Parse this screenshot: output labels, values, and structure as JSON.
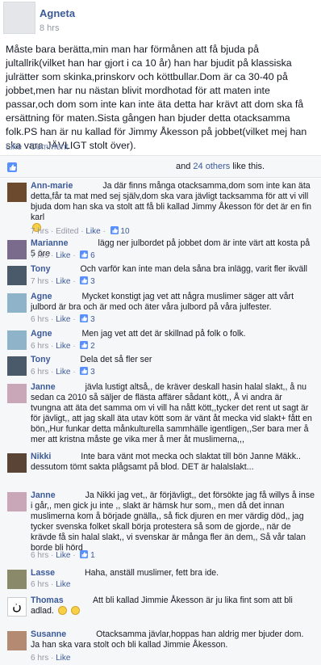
{
  "post": {
    "author": "Agneta",
    "time": "8 hrs",
    "text": "Måste bara berätta,min man har förmånen att få bjuda på jultallrik(vilket han har gjort i ca 10 år) han har bjudit på klassiska julrätter som skinka,prinskorv och köttbullar.Dom är ca 30-40 på jobbet,men har nu nästan blivit mordhotad för att maten inte passar,och dom som inte kan inte äta detta har krävt att dom ska få ersättning för maten.Sista gången han bjuder detta otacksamma folk.PS han är nu kallad för Jimmy Åkesson på jobbet(vilket mej han ska vara JÄVLIGT stolt över).",
    "like_label": "Like",
    "comment_label": "Comment",
    "likes_prefix": "and",
    "likes_link": "24 others",
    "likes_suffix": "like this."
  },
  "comments": [
    {
      "name": "Ann-marie",
      "text": "Ja där finns många otacksamma,dom som inte kan äta detta,får ta mat med sej själv,dom ska vara jävligt tacksamma för att vi vill bjuda dom han ska va stolt att få bli kallad Jimmy Åkesson för det är en fin karl",
      "time": "7 hrs",
      "edited": "Edited",
      "like": "Like",
      "count": "10"
    },
    {
      "name": "Marianne",
      "text": "lägg ner julbordet på jobbet dom är inte värt att kosta på 5 öre",
      "time": "7 hrs",
      "like": "Like",
      "count": "6"
    },
    {
      "name": "Tony",
      "text": "Och varför kan inte man dela såna bra inlägg, varit fler ikväll",
      "time": "7 hrs",
      "like": "Like",
      "count": "3"
    },
    {
      "name": "Agne",
      "text": "Mycket konstigt jag vet att några muslimer säger att vårt julbord är bra och är med och äter våra julbord på våra julfester.",
      "time": "6 hrs",
      "like": "Like",
      "count": "3"
    },
    {
      "name": "Agne",
      "text": "Men jag vet att det är skillnad på folk o folk.",
      "time": "6 hrs",
      "like": "Like",
      "count": "2"
    },
    {
      "name": "Tony",
      "text": "Dela det så fler ser",
      "time": "6 hrs",
      "like": "Like",
      "count": "3"
    },
    {
      "name": "Janne",
      "text": "jävla lustigt altså,, de kräver deskall hasin halal slakt,, å nu sedan ca 2010 så säljer de flästa affärer sådant kött,, Å vi andra är tvungna att äta det samma om vi vill ha nått kött,,tycker det rent ut sagt är för jävligt,, att jag skall äta utav kött som är vänt åt mecka vid slakt+ fått en bön,,Hur funkar detta månkulturella sammhälle igentligen,,Ser bara mer å mer att kristna måste ge vika mer å mer åt muslimerna,,,",
      "time": "",
      "like": "",
      "count": ""
    },
    {
      "name": "Nikki",
      "text": "Inte bara vänt mot mecka och slaktat till bön Janne Mäkk.. dessutom tömt sakta plågsamt på blod. DET är halalslakt...",
      "time": "",
      "like": "",
      "count": ""
    },
    {
      "name": "Janne",
      "text": "Ja Nikki jag vet,, är förjävligt,, det försökte jag få willys å inse i går,, men gick ju inte ,, slakt är hämsk hur som,, men då det innan muslimerna kom å började gnälla,, så fick djuren en mer värdig död,, jag tycker svenska folket skall börja protestera så som de gjorde,, när de krävde få sin halal slakt,, vi svenskar är många fler än dem,, Så vår talan borde bli hörd",
      "time": "6 hrs",
      "like": "Like",
      "count": "1"
    },
    {
      "name": "Lasse",
      "text": "Haha, anställ muslimer, fett bra ide.",
      "time": "6 hrs",
      "like": "Like",
      "count": ""
    },
    {
      "name": "Thomas",
      "text": "Att bli kallad Jimmie Åkesson är ju lika fint som att bli adlad.",
      "time": "",
      "like": "",
      "count": ""
    },
    {
      "name": "Susanne",
      "text": "Otacksamma jävlar,hoppas han aldrig mer bjuder dom. Ja han ska vara stolt och bli kallad Jimmie Åkesson.",
      "time": "6 hrs",
      "like": "Like",
      "count": ""
    }
  ],
  "colors": {
    "link": "#3b5998",
    "muted": "#9197a3",
    "bg": "#f6f7f9"
  }
}
